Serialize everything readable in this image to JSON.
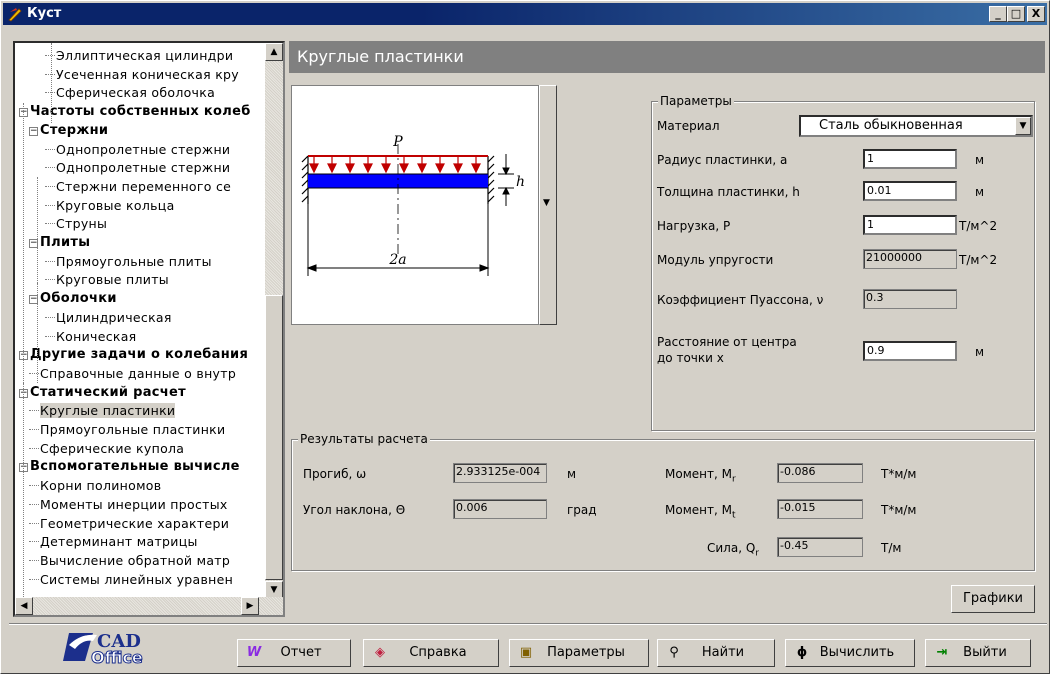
{
  "window": {
    "title": "Куст",
    "minimize": "_",
    "maximize": "□",
    "close": "X"
  },
  "tree": {
    "items": [
      {
        "label": "Эллиптическая цилиндри",
        "level": 2,
        "bold": false
      },
      {
        "label": "Усеченная коническая кру",
        "level": 2,
        "bold": false
      },
      {
        "label": "Сферическая оболочка",
        "level": 2,
        "bold": false
      },
      {
        "label": "Частоты собственных колеб",
        "level": 0,
        "bold": true,
        "expander": "−"
      },
      {
        "label": "Стержни",
        "level": 1,
        "bold": true,
        "expander": "−"
      },
      {
        "label": "Однопролетные стержни",
        "level": 2,
        "bold": false
      },
      {
        "label": "Однопролетные стержни",
        "level": 2,
        "bold": false
      },
      {
        "label": "Стержни переменного се",
        "level": 2,
        "bold": false
      },
      {
        "label": "Круговые кольца",
        "level": 2,
        "bold": false
      },
      {
        "label": "Струны",
        "level": 2,
        "bold": false
      },
      {
        "label": "Плиты",
        "level": 1,
        "bold": true,
        "expander": "−"
      },
      {
        "label": "Прямоугольные плиты",
        "level": 2,
        "bold": false
      },
      {
        "label": "Круговые плиты",
        "level": 2,
        "bold": false
      },
      {
        "label": "Оболочки",
        "level": 1,
        "bold": true,
        "expander": "−"
      },
      {
        "label": "Цилиндрическая",
        "level": 2,
        "bold": false
      },
      {
        "label": "Коническая",
        "level": 2,
        "bold": false
      },
      {
        "label": "Другие задачи о колебания",
        "level": 0,
        "bold": true,
        "expander": "−"
      },
      {
        "label": "Справочные данные о внутр",
        "level": 1,
        "bold": false
      },
      {
        "label": "Статический расчет",
        "level": 0,
        "bold": true,
        "expander": "−"
      },
      {
        "label": "Круглые пластинки",
        "level": 1,
        "bold": false,
        "selected": true
      },
      {
        "label": "Прямоугольные пластинки",
        "level": 1,
        "bold": false
      },
      {
        "label": "Сферические купола",
        "level": 1,
        "bold": false
      },
      {
        "label": "Вспомогательные вычисле",
        "level": 0,
        "bold": true,
        "expander": "−"
      },
      {
        "label": "Корни полиномов",
        "level": 1,
        "bold": false
      },
      {
        "label": "Моменты инерции простых",
        "level": 1,
        "bold": false
      },
      {
        "label": "Геометрические характери",
        "level": 1,
        "bold": false
      },
      {
        "label": "Детерминант матрицы",
        "level": 1,
        "bold": false
      },
      {
        "label": "Вычисление обратной матр",
        "level": 1,
        "bold": false
      },
      {
        "label": "Системы линейных уравнен",
        "level": 1,
        "bold": false
      }
    ]
  },
  "panel": {
    "title": "Круглые пластинки",
    "diagram": {
      "load_label": "P",
      "thickness_label": "h",
      "span_label": "2a"
    },
    "params": {
      "title": "Параметры",
      "material_label": "Материал",
      "material_value": "Сталь обыкновенная",
      "radius_label": "Радиус пластинки, a",
      "radius_value": "1",
      "radius_unit": "м",
      "thickness_label": "Толщина пластинки, h",
      "thickness_value": "0.01",
      "thickness_unit": "м",
      "load_label": "Нагрузка, P",
      "load_value": "1",
      "load_unit": "Т/м^2",
      "modulus_label": "Модуль упругости",
      "modulus_value": "21000000",
      "modulus_unit": "Т/м^2",
      "poisson_label": "Коэффициент Пуассона, ν",
      "poisson_value": "0.3",
      "distance_label_1": "Расстояние от центра",
      "distance_label_2": "до точки x",
      "distance_value": "0.9",
      "distance_unit": "м"
    },
    "results": {
      "title": "Результаты расчета",
      "deflection_label": "Прогиб, ω",
      "deflection_value": "2.933125e-004",
      "deflection_unit": "м",
      "slope_label": "Угол наклона, Θ",
      "slope_value": "0.006",
      "slope_unit": "град",
      "mr_label": "Момент, M",
      "mr_sub": "r",
      "mr_value": "-0.086",
      "mr_unit": "Т*м/м",
      "mt_label": "Момент, M",
      "mt_sub": "t",
      "mt_value": "-0.015",
      "mt_unit": "Т*м/м",
      "q_label": "Сила, Q",
      "q_sub": "r",
      "q_value": "-0.45",
      "q_unit": "Т/м"
    },
    "graphs_button": "Графики"
  },
  "toolbar": {
    "logo_text_1": "CAD",
    "logo_text_2": "Office",
    "report": "Отчет",
    "help": "Справка",
    "params": "Параметры",
    "find": "Найти",
    "calc": "Вычислить",
    "exit": "Выйти"
  },
  "colors": {
    "title_bar": "#0a246a",
    "panel_header": "#808080",
    "beam_blue": "#0000ff",
    "load_red": "#c00000",
    "logo_blue": "#1c2f8c"
  }
}
